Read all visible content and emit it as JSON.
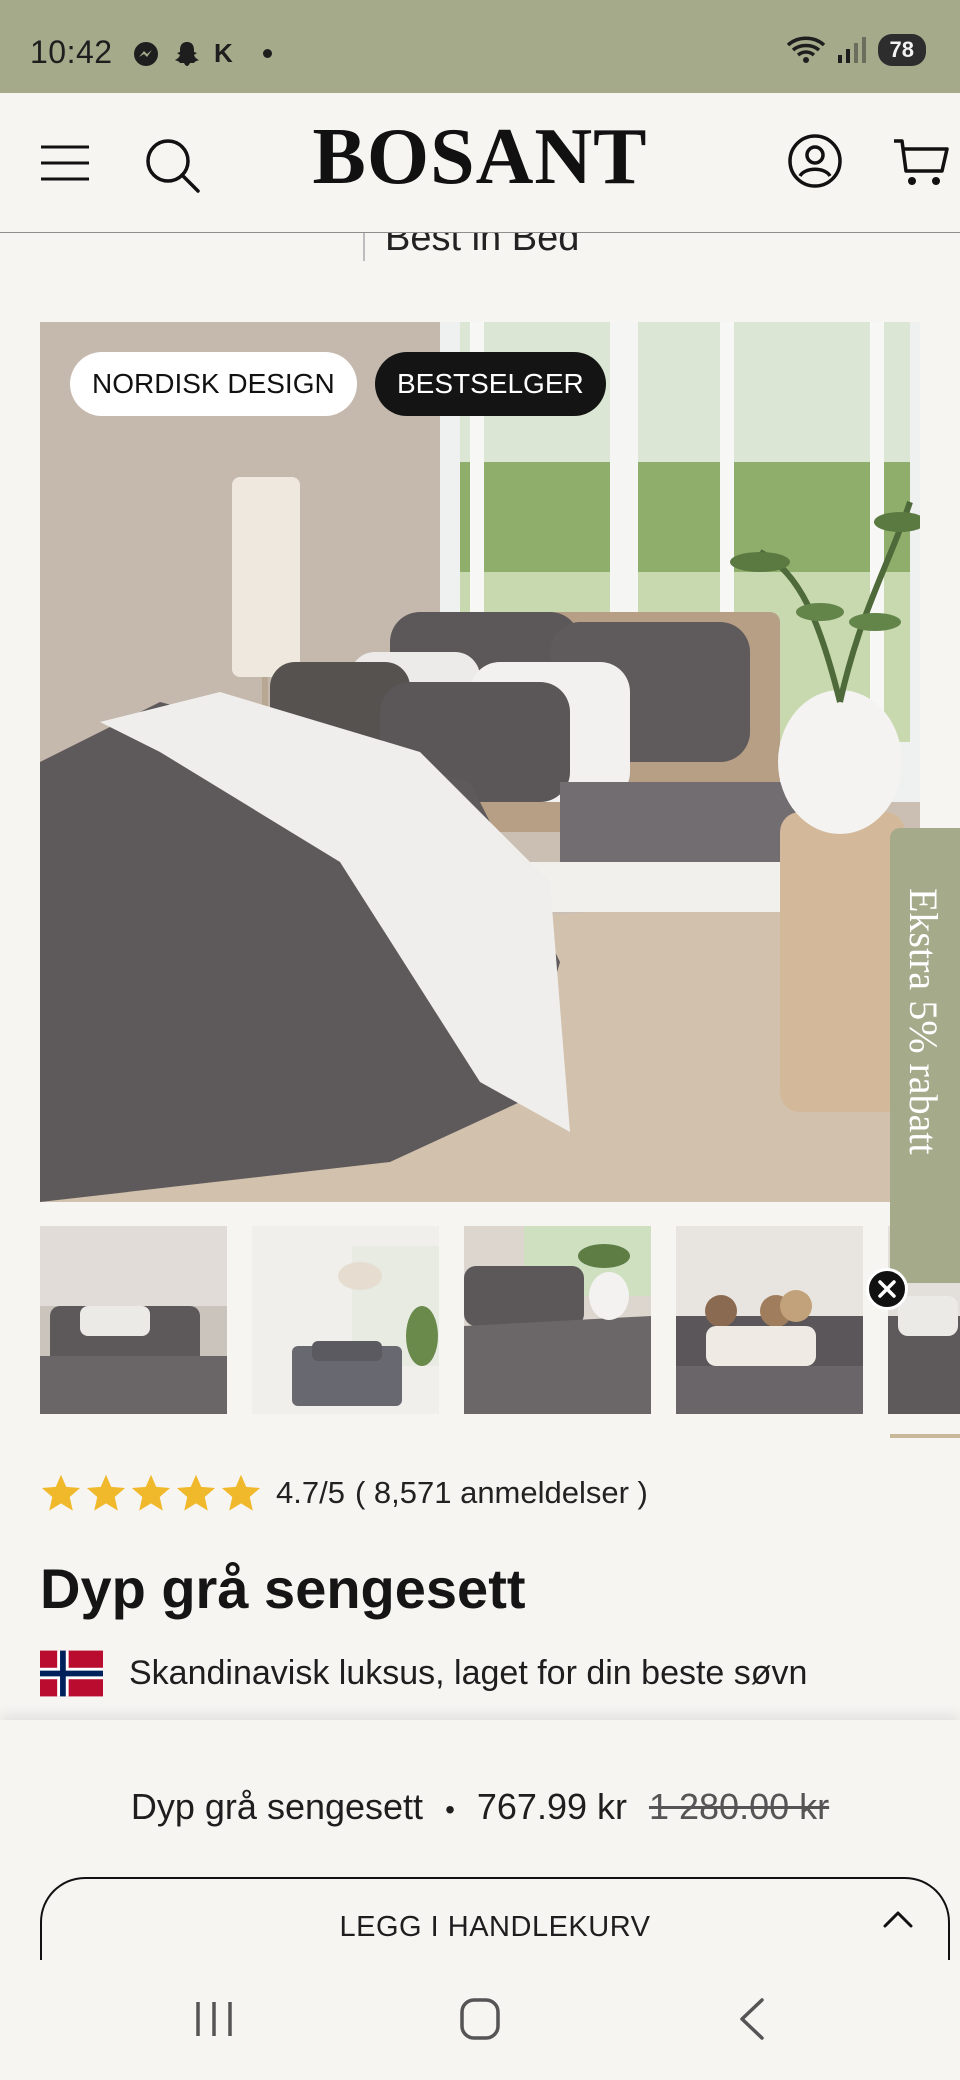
{
  "status_bar": {
    "time": "10:42",
    "carrier_letter": "K",
    "battery": "78",
    "icons_left": [
      "messenger-icon",
      "snapchat-icon"
    ],
    "icons_right": [
      "wifi-icon",
      "signal-icon",
      "battery-icon"
    ]
  },
  "header": {
    "logo": "BOSANT",
    "icons": [
      "menu-icon",
      "search-icon",
      "account-icon",
      "cart-icon"
    ]
  },
  "partial_heading": "Best in Bed",
  "hero": {
    "badges": [
      "NORDISK DESIGN",
      "BESTSELGER"
    ]
  },
  "promo_tab": {
    "label": "Ekstra 5% rabatt"
  },
  "thumbnails": {
    "count_visible": 5,
    "selected_index": 0
  },
  "rating": {
    "stars": 5,
    "score": "4.7/5",
    "reviews": "( 8,571 anmeldelser )",
    "star_color": "#f0b92b"
  },
  "product": {
    "title": "Dyp grå sengesett",
    "tagline": "Skandinavisk luksus, laget for din beste søvn"
  },
  "sticky_bar": {
    "name": "Dyp grå sengesett",
    "separator": "•",
    "price": "767.99 kr",
    "old_price": "1 280.00 kr",
    "button": "LEGG I HANDLEKURV"
  },
  "colors": {
    "accent_olive": "#a4aa8a",
    "background": "#f7f5f2",
    "text": "#1b1b1b"
  },
  "nav_bar": {
    "buttons": [
      "recent-apps-icon",
      "home-icon",
      "back-icon"
    ]
  }
}
